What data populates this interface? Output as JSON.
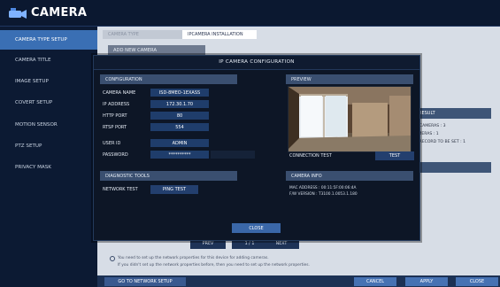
{
  "app": {
    "title": "CAMERA"
  },
  "sidebar": {
    "items": [
      {
        "label": "CAMERA TYPE SETUP"
      },
      {
        "label": "CAMERA TITLE"
      },
      {
        "label": "IMAGE SETUP"
      },
      {
        "label": "COVERT SETUP"
      },
      {
        "label": "MOTION SENSOR"
      },
      {
        "label": "PTZ SETUP"
      },
      {
        "label": "PRIVACY MASK"
      }
    ]
  },
  "background": {
    "tabs": [
      {
        "label": "CAMERA TYPE"
      },
      {
        "label": "IPCAMERA INSTALLATION"
      }
    ],
    "add_new_camera": "ADD NEW CAMERA",
    "result_header": "RESULT",
    "result_lines": [
      "ED CAMERAS : 3",
      "CAMERAS : 1",
      "AS RECORD TO BE SET : 1"
    ],
    "notice_line1": "You need to set up the network properties for this device for adding cameras.",
    "notice_line2": "If you didn't set up the network properties before, then you need to set up the network properties.",
    "nav": {
      "prev": "PREV",
      "page": "1 / 1",
      "next": "NEXT"
    },
    "buttons": {
      "network_setup": "GO TO NETWORK SETUP",
      "cancel": "CANCEL",
      "apply": "APPLY",
      "close": "CLOSE"
    }
  },
  "dialog": {
    "title": "IP CAMERA CONFIGURATION",
    "configuration": {
      "header": "CONFIGURATION",
      "fields": [
        {
          "label": "CAMERA NAME",
          "value": "ISD-8MEO-1EXASS"
        },
        {
          "label": "IP ADDRESS",
          "value": "172.30.1.70"
        },
        {
          "label": "HTTP PORT",
          "value": "80"
        },
        {
          "label": "RTSP PORT",
          "value": "554"
        },
        {
          "label": "USER ID",
          "value": "ADMIN"
        },
        {
          "label": "PASSWORD",
          "value": "**********"
        }
      ]
    },
    "preview": {
      "header": "PREVIEW",
      "connection_test_label": "CONNECTION TEST",
      "test_button": "TEST"
    },
    "diagnostic": {
      "header": "DIAGNOSTIC TOOLS",
      "network_test_label": "NETWORK TEST",
      "ping_button": "PING TEST"
    },
    "camera_info": {
      "header": "CAMERA INFO",
      "mac": "MAC ADDRESS : 00:11:5F:00:06:4A",
      "fw": "F/W VERSION : T3100.1.0053.1.180"
    },
    "close_button": "CLOSE"
  },
  "colors": {
    "accent": "#3a6fb4",
    "field_bg": "#1f3d6b",
    "panel_header": "#3a4f70",
    "dialog_bg": "#0d1626"
  }
}
